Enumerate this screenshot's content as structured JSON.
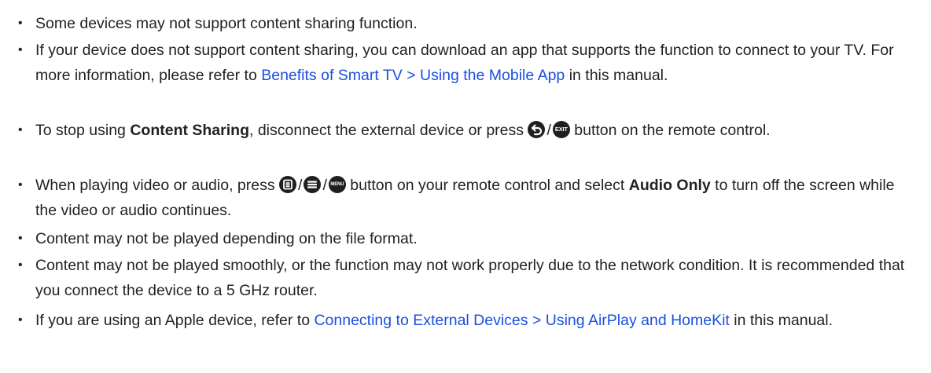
{
  "notes": [
    {
      "text": "Some devices may not support content sharing function."
    },
    {
      "pre": "If your device does not support content sharing, you can download an app that supports the function to connect to your TV. For more information, please refer to ",
      "link": "Benefits of Smart TV > Using the Mobile App",
      "post": " in this manual."
    },
    {
      "pre": "To stop using ",
      "bold": "Content Sharing",
      "mid": ", disconnect the external device or press ",
      "slash": "/",
      "post": " button on the remote control.",
      "icons": [
        "back-icon",
        "exit-icon"
      ],
      "icon_labels": {
        "exit": "EXIT"
      }
    },
    {
      "pre": "When playing video or audio, press ",
      "slash1": "/",
      "slash2": "/",
      "mid": " button on your remote control and select ",
      "bold": "Audio Only",
      "post": " to turn off the screen while the video or audio continues.",
      "icons": [
        "options-icon",
        "menu-lines-icon",
        "menu-icon"
      ],
      "icon_labels": {
        "menu": "MENU"
      }
    },
    {
      "text": "Content may not be played depending on the file format."
    },
    {
      "text": "Content may not be played smoothly, or the function may not work properly due to the network condition. It is recommended that you connect the device to a 5 GHz router."
    },
    {
      "pre": "If you are using an Apple device, refer to ",
      "link": "Connecting to External Devices > Using AirPlay and HomeKit",
      "post": " in this manual."
    }
  ],
  "bullet": "•",
  "colors": {
    "link": "#1a4fe0",
    "text": "#222222",
    "icon": "#1f1f1f"
  }
}
